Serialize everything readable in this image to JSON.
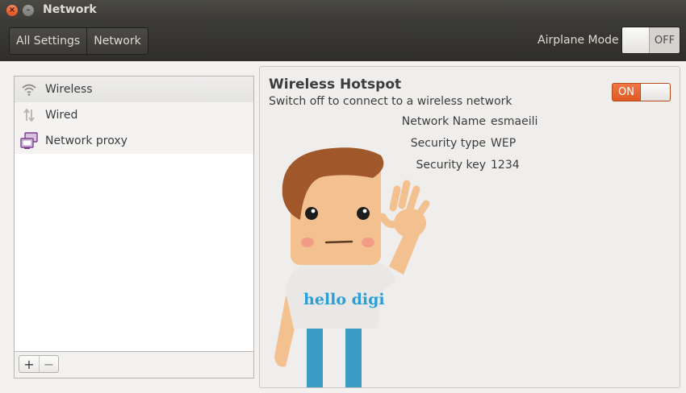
{
  "window": {
    "title": "Network"
  },
  "toolbar": {
    "breadcrumbs": [
      "All Settings",
      "Network"
    ],
    "airplane_mode_label": "Airplane Mode",
    "airplane_mode_state": "OFF"
  },
  "sidebar": {
    "items": [
      {
        "label": "Wireless",
        "icon": "wifi-icon"
      },
      {
        "label": "Wired",
        "icon": "wired-arrows-icon"
      },
      {
        "label": "Network proxy",
        "icon": "network-proxy-icon"
      }
    ],
    "add_label": "+",
    "remove_label": "−"
  },
  "hotspot": {
    "title": "Wireless Hotspot",
    "subtitle": "Switch off to connect to a wireless network",
    "toggle_state": "ON",
    "details": [
      {
        "label": "Network Name",
        "value": "esmaeili"
      },
      {
        "label": "Security type",
        "value": "WEP"
      },
      {
        "label": "Security key",
        "value": "1234"
      }
    ],
    "mascot_shirt_text": "hello digi"
  },
  "colors": {
    "titlebar": "#3c3b37",
    "accent_orange": "#df5a23",
    "window_bg": "#f2f1f0",
    "mascot_text": "#2a9fd6"
  }
}
